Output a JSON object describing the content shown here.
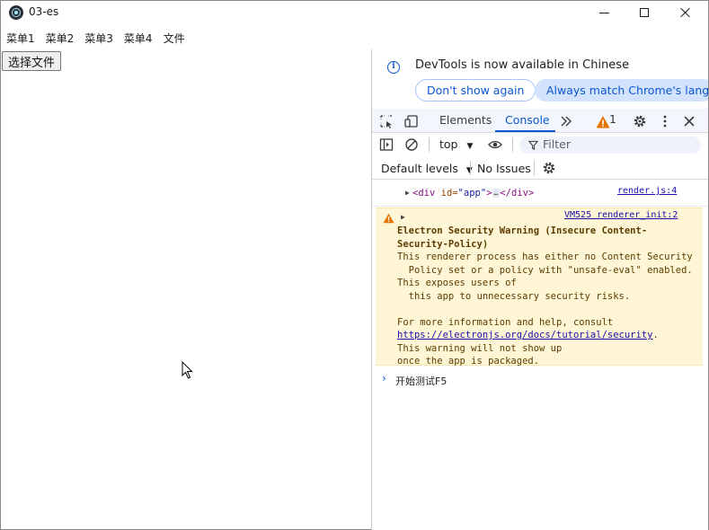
{
  "window": {
    "title": "03-es"
  },
  "menubar": {
    "items": [
      "菜单1",
      "菜单2",
      "菜单3",
      "菜单4",
      "文件"
    ]
  },
  "app": {
    "file_button_label": "选择文件"
  },
  "devtools": {
    "infobar": {
      "message": "DevTools is now available in Chinese",
      "dont_show_label": "Don't show again",
      "always_match_label": "Always match Chrome's language"
    },
    "tabs": {
      "elements": "Elements",
      "console": "Console",
      "warning_count": "1"
    },
    "toolbar": {
      "context": "top",
      "filter_placeholder": "Filter",
      "levels": "Default levels",
      "issues": "No Issues"
    },
    "console": {
      "entry1": {
        "tag_open": "<div",
        "attr_name": " id=",
        "attr_value": "\"app\"",
        "tag_close_open": ">",
        "ellipsis": "…",
        "tag_end": "</div>",
        "source": "render.js:4"
      },
      "warning": {
        "source": "VM525 renderer_init:2",
        "title_line1": "Electron Security Warning (Insecure Content-",
        "title_line2": "Security-Policy)",
        "body_lines": [
          "This renderer process has either no Content Security",
          "  Policy set or a policy with \"unsafe-eval\" enabled.",
          "This exposes users of",
          "  this app to unnecessary security risks.",
          "",
          "For more information and help, consult"
        ],
        "link": "https://electronjs.org/docs/tutorial/security",
        "link_suffix": ".",
        "tail_lines": [
          "This warning will not show up",
          "once the app is packaged."
        ]
      },
      "entry3": {
        "text": "开始测试F5"
      }
    }
  }
}
